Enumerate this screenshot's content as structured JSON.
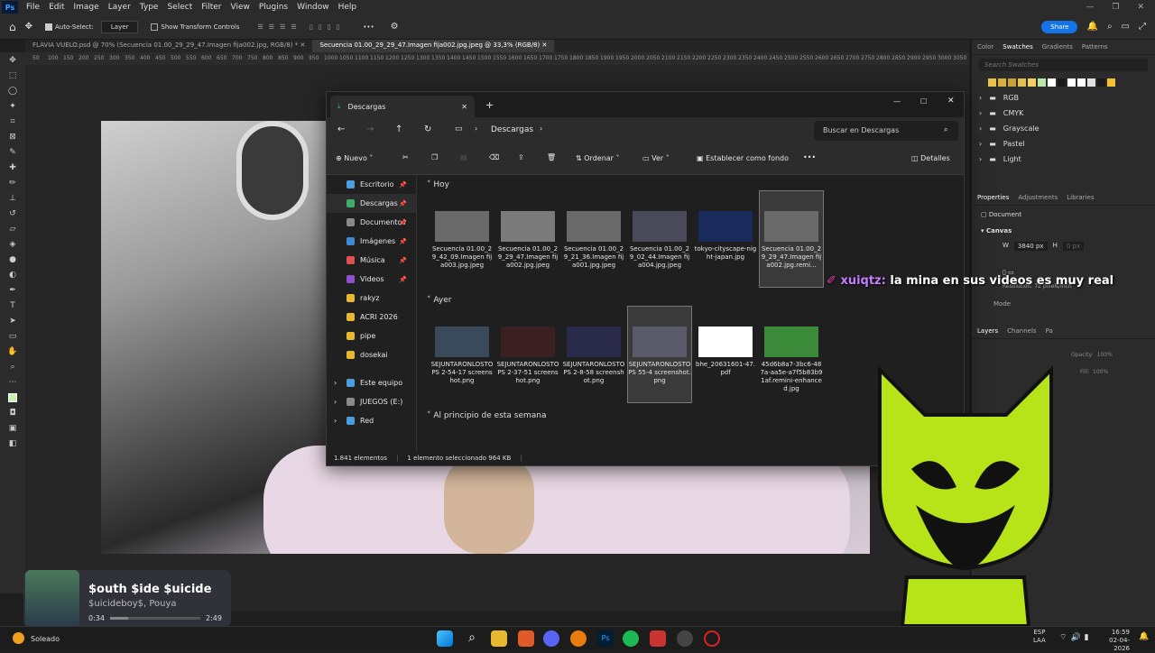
{
  "app": {
    "logo": "Ps",
    "menu": [
      "File",
      "Edit",
      "Image",
      "Layer",
      "Type",
      "Select",
      "Filter",
      "View",
      "Plugins",
      "Window",
      "Help"
    ]
  },
  "options": {
    "auto_select": "Auto-Select:",
    "layer_select": "Layer",
    "show_transform": "Show Transform Controls",
    "more": "•••",
    "share": "Share"
  },
  "doc_tabs": [
    "FLAVIA VUELO.psd @ 70% (Secuencia 01.00_29_29_47.Imagen fija002.jpg, RGB/8) *",
    "Secuencia 01.00_29_29_47.Imagen fija002.jpg.jpeg @ 33,3% (RGB/8)"
  ],
  "ruler_ticks": [
    "50",
    "100",
    "150",
    "200",
    "250",
    "300",
    "350",
    "400",
    "450",
    "500",
    "550",
    "600",
    "650",
    "700",
    "750",
    "800",
    "850",
    "900",
    "950",
    "1000",
    "1050",
    "1100",
    "1150",
    "1200",
    "1250",
    "1300",
    "1350",
    "1400",
    "1450",
    "1500",
    "1550",
    "1600",
    "1650",
    "1700",
    "1750",
    "1800",
    "1850",
    "1900",
    "1950",
    "2000",
    "2050",
    "2100",
    "2150",
    "2200",
    "2250",
    "2300",
    "2350",
    "2400",
    "2450",
    "2500",
    "2550",
    "2600",
    "2650",
    "2700",
    "2750",
    "2800",
    "2850",
    "2900",
    "2950",
    "3000",
    "3050"
  ],
  "right_panel": {
    "tabs": [
      "Color",
      "Swatches",
      "Gradients",
      "Patterns"
    ],
    "search_placeholder": "Search Swatches",
    "swatch_colors": [
      "#e8c14a",
      "#d8b040",
      "#c9a33a",
      "#e0c050",
      "#f0d060",
      "#b8e8a8",
      "#ffffff",
      "#1a1a1a",
      "#ffffff",
      "#ffffff",
      "#e0e0e0",
      "#1a1a1a",
      "#f0c030"
    ],
    "folders": [
      "RGB",
      "CMYK",
      "Grayscale",
      "Pastel",
      "Light"
    ],
    "props_tabs": [
      "Properties",
      "Adjustments",
      "Libraries"
    ],
    "document_label": "Document",
    "canvas_label": "Canvas",
    "w_label": "W",
    "w_value": "3840 px",
    "h_label": "H",
    "h_value": "0 px",
    "resolution": "Resolution: 72 pixels/inch",
    "mode_label": "Mode",
    "layers_tabs": [
      "Layers",
      "Channels",
      "Pa"
    ],
    "opacity_label": "Opacity:",
    "opacity_value": "100%",
    "fill_label": "Fill:",
    "fill_value": "100%"
  },
  "explorer": {
    "tab_title": "Descargas",
    "breadcrumb": "Descargas",
    "search_placeholder": "Buscar en Descargas",
    "cmd": {
      "new": "Nuevo",
      "sort": "Ordenar",
      "view": "Ver",
      "set_bg": "Establecer como fondo",
      "details": "Detalles"
    },
    "nav": [
      {
        "label": "Escritorio",
        "color": "#4a9ee0",
        "pinned": true
      },
      {
        "label": "Descargas",
        "color": "#3fae6a",
        "pinned": true
      },
      {
        "label": "Documentos",
        "color": "#8a8a8a",
        "pinned": true
      },
      {
        "label": "Imágenes",
        "color": "#3a8ad8",
        "pinned": true
      },
      {
        "label": "Música",
        "color": "#e05050",
        "pinned": true
      },
      {
        "label": "Videos",
        "color": "#9050d0",
        "pinned": true
      },
      {
        "label": "rakyz",
        "color": "#e8b830",
        "pinned": false
      },
      {
        "label": "ACRI 2026",
        "color": "#e8b830",
        "pinned": false
      },
      {
        "label": "pipe",
        "color": "#e8b830",
        "pinned": false
      },
      {
        "label": "dosekai",
        "color": "#e8b830",
        "pinned": false
      },
      {
        "label": "Este equipo",
        "color": "#4a9ee0",
        "pinned": false
      },
      {
        "label": "JUEGOS (E:)",
        "color": "#8a8a8a",
        "pinned": false
      },
      {
        "label": "Red",
        "color": "#4a9ee0",
        "pinned": false
      }
    ],
    "groups": [
      {
        "title": "Hoy",
        "items": [
          "Secuencia 01.00_29_42_09.Imagen fija003.jpg.jpeg",
          "Secuencia 01.00_29_29_47.Imagen fija002.jpg.jpeg",
          "Secuencia 01.00_29_21_36.Imagen fija001.jpg.jpeg",
          "Secuencia 01.00_29_02_44.Imagen fija004.jpg.jpeg",
          "tokyo-cityscape-night-japan.jpg",
          "Secuencia 01.00_29_29_47.Imagen fija002.jpg.remi..."
        ]
      },
      {
        "title": "Ayer",
        "items": [
          "SEJUNTARONLOSTOPS 2-54-17 screenshot.png",
          "SEJUNTARONLOSTOPS 2-37-51 screenshot.png",
          "SEJUNTARONLOSTOPS 2-8-58 screenshot.png",
          "SEJUNTARONLOSTOPS 55-4 screenshot.png",
          "bhe_20631601-47.pdf",
          "45d6b8a7-3bc6-487a-aa5e-a7f5b83b91af.remini-enhanced.jpg"
        ]
      },
      {
        "title": "Al principio de esta semana",
        "items": []
      }
    ],
    "status_count": "1.841 elementos",
    "status_selected": "1 elemento seleccionado  964 KB"
  },
  "chat": {
    "user": "xuiqtz:",
    "message": "la mina en sus videos es muy real"
  },
  "music": {
    "title": "$outh $ide $uicide",
    "artist": "$uicideboy$, Pouya",
    "elapsed": "0:34",
    "duration": "2:49",
    "progress": 0.2
  },
  "taskbar": {
    "weather": "Soleado",
    "lang1": "ESP",
    "lang2": "LAA",
    "time": "16:59",
    "date": "02-04-2026"
  }
}
